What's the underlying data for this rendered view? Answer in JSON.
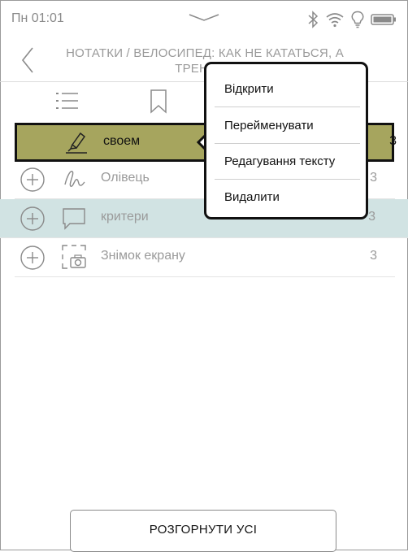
{
  "status_bar": {
    "time": "Пн 01:01",
    "icons": [
      "chevron-down-icon",
      "bluetooth-icon",
      "wifi-icon",
      "lightbulb-icon",
      "battery-icon"
    ]
  },
  "header": {
    "title": "НОТАТКИ / ВЕЛОСИПЕД: КАК НЕ КАТАТЬСЯ, А ТРЕНИРО"
  },
  "tabs": [
    "list-icon",
    "bookmark-icon"
  ],
  "rows": [
    {
      "label": "своем",
      "count": "3",
      "icon": "highlighter-icon",
      "state": "selected"
    },
    {
      "label": "Олівець",
      "count": "3",
      "icon": "pencil-scribble-icon",
      "state": "normal"
    },
    {
      "label": "критери",
      "count": "3",
      "icon": "comment-icon",
      "state": "highlighted"
    },
    {
      "label": "Знімок екрану",
      "count": "3",
      "icon": "screenshot-icon",
      "state": "normal"
    }
  ],
  "context_menu": {
    "items": [
      "Відкрити",
      "Перейменувати",
      "Редагування тексту",
      "Видалити"
    ]
  },
  "footer": {
    "expand_all_label": "РОЗГОРНУТИ УСІ"
  },
  "colors": {
    "selected_row": "#a6a55e",
    "highlighted_row": "#d1e3e3",
    "muted_text": "#9a9a9a"
  }
}
